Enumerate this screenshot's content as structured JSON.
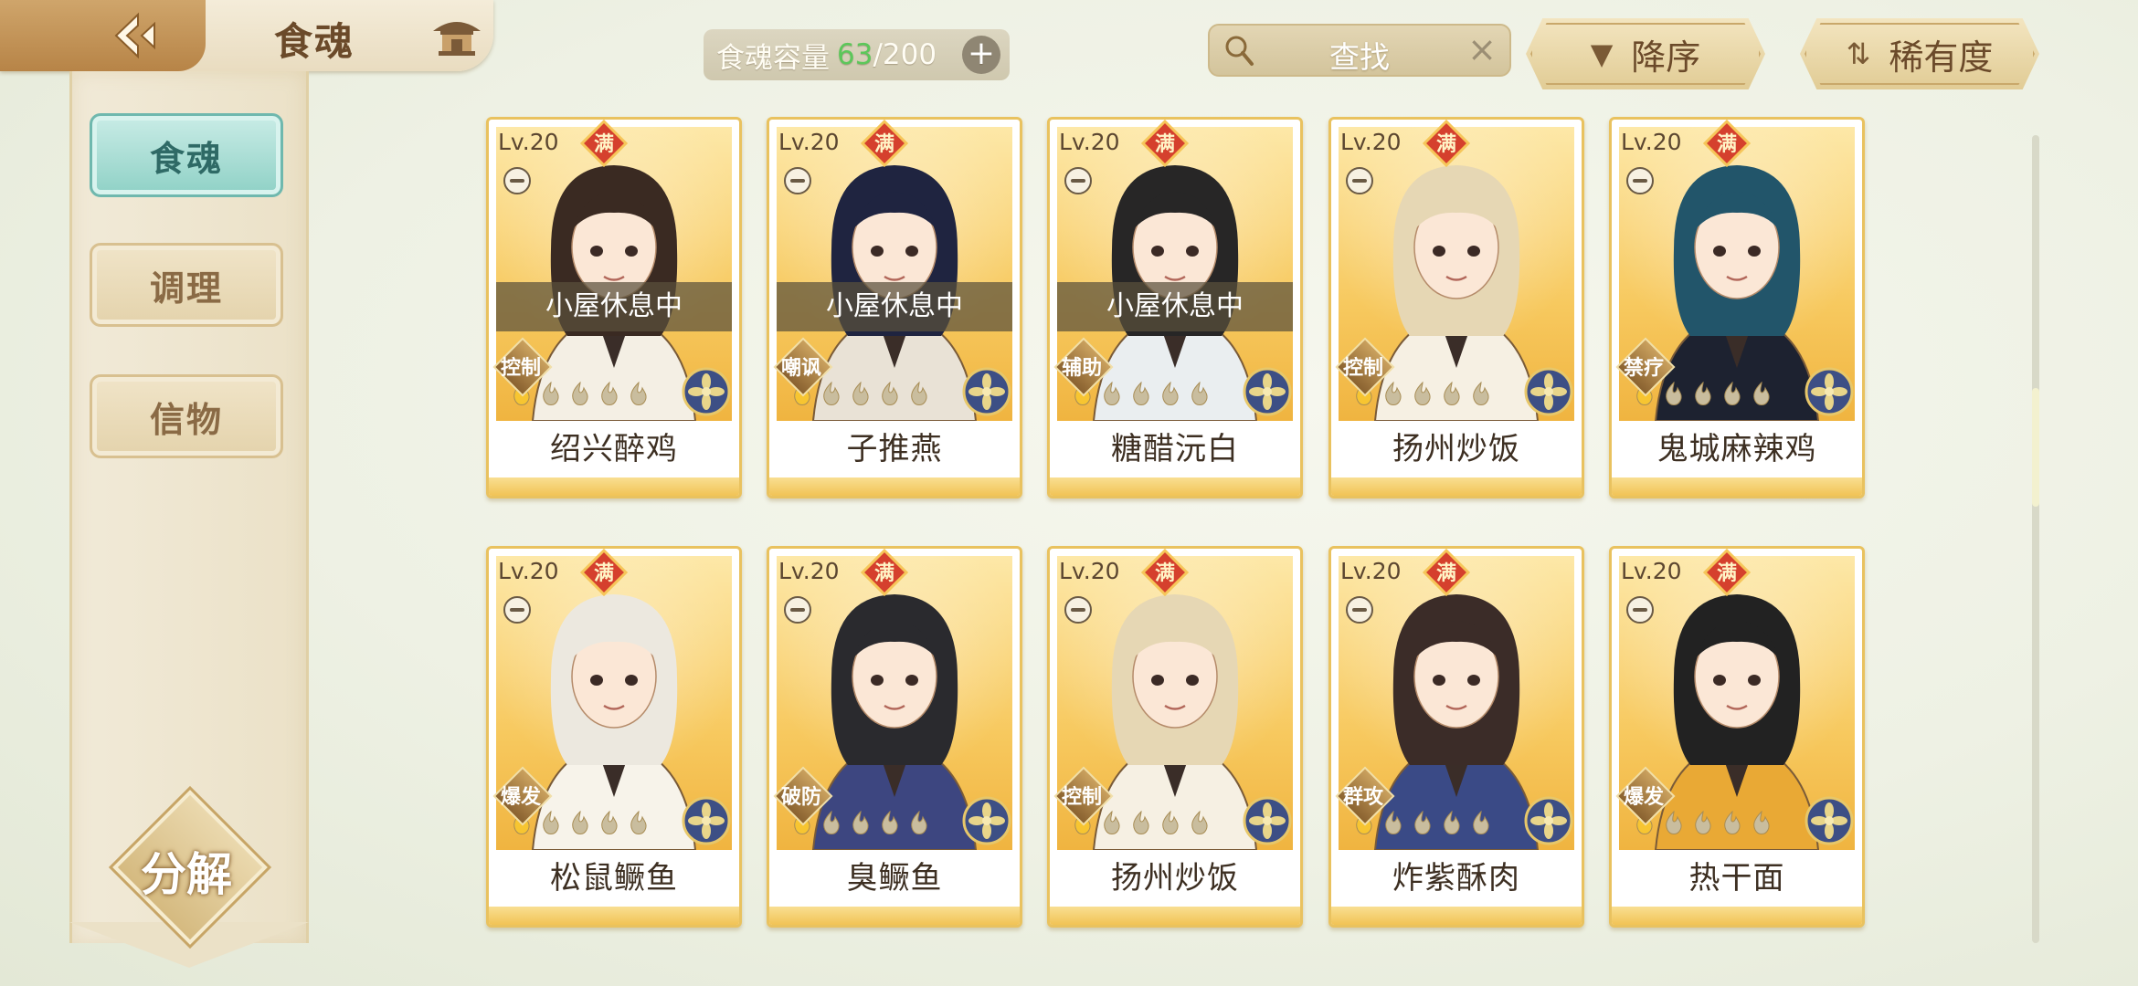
{
  "header": {
    "title": "食魂",
    "capacity_label": "食魂容量",
    "capacity_current": "63",
    "capacity_max": "/200",
    "capacity_add": "+",
    "search_text": "查找",
    "search_clear": "×",
    "sort_order_label": "降序",
    "sort_key_label": "稀有度"
  },
  "sidebar": {
    "tabs": [
      {
        "label": "食魂",
        "active": true
      },
      {
        "label": "调理",
        "active": false
      },
      {
        "label": "信物",
        "active": false
      }
    ],
    "decompose_label": "分解"
  },
  "cards": [
    {
      "level": "Lv.20",
      "badge": "满",
      "status": "小屋休息中",
      "role": "控制",
      "name": "绍兴醉鸡",
      "stars_filled": 1,
      "stars_total": 5,
      "hair": "#3a2a22",
      "robe": "#f4efe4"
    },
    {
      "level": "Lv.20",
      "badge": "满",
      "status": "小屋休息中",
      "role": "嘲讽",
      "name": "子推燕",
      "stars_filled": 1,
      "stars_total": 5,
      "hair": "#1f2440",
      "robe": "#e9e2d6"
    },
    {
      "level": "Lv.20",
      "badge": "满",
      "status": "小屋休息中",
      "role": "辅助",
      "name": "糖醋沅白",
      "stars_filled": 1,
      "stars_total": 5,
      "hair": "#272626",
      "robe": "#eaeef0"
    },
    {
      "level": "Lv.20",
      "badge": "满",
      "status": "",
      "role": "控制",
      "name": "扬州炒饭",
      "stars_filled": 1,
      "stars_total": 5,
      "hair": "#e6d7b4",
      "robe": "#f6f0e3"
    },
    {
      "level": "Lv.20",
      "badge": "满",
      "status": "",
      "role": "禁疗",
      "name": "鬼城麻辣鸡",
      "stars_filled": 1,
      "stars_total": 5,
      "hair": "#22556a",
      "robe": "#1d2230"
    },
    {
      "level": "Lv.20",
      "badge": "满",
      "status": "",
      "role": "爆发",
      "name": "松鼠鳜鱼",
      "stars_filled": 1,
      "stars_total": 5,
      "hair": "#ece8df",
      "robe": "#f7f3ea"
    },
    {
      "level": "Lv.20",
      "badge": "满",
      "status": "",
      "role": "破防",
      "name": "臭鳜鱼",
      "stars_filled": 1,
      "stars_total": 5,
      "hair": "#2a2a2e",
      "robe": "#3d4680"
    },
    {
      "level": "Lv.20",
      "badge": "满",
      "status": "",
      "role": "控制",
      "name": "扬州炒饭",
      "stars_filled": 1,
      "stars_total": 5,
      "hair": "#e6d7b4",
      "robe": "#f6f0e3"
    },
    {
      "level": "Lv.20",
      "badge": "满",
      "status": "",
      "role": "群攻",
      "name": "炸紫酥肉",
      "stars_filled": 1,
      "stars_total": 5,
      "hair": "#3b2c28",
      "robe": "#3a4a86"
    },
    {
      "level": "Lv.20",
      "badge": "满",
      "status": "",
      "role": "爆发",
      "name": "热干面",
      "stars_filled": 1,
      "stars_total": 5,
      "hair": "#222",
      "robe": "#e9a935"
    }
  ]
}
